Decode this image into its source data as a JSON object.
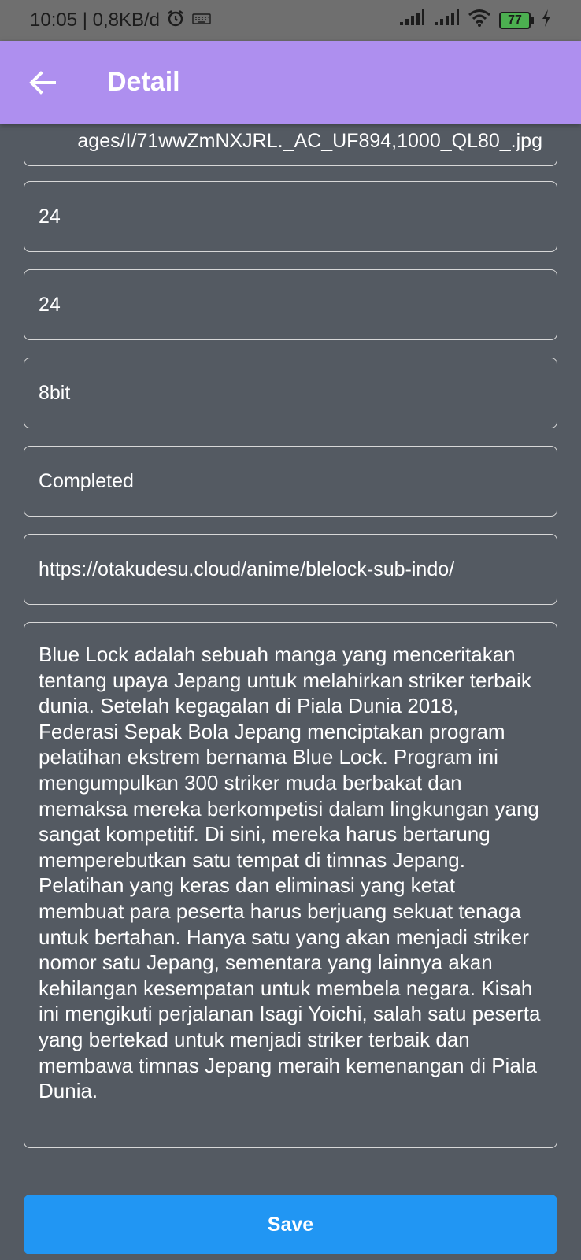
{
  "status_bar": {
    "time_speed": "10:05 | 0,8KB/d",
    "battery": "77"
  },
  "app_bar": {
    "title": "Detail"
  },
  "form": {
    "image_url": "ages/I/71wwZmNXJRL._AC_UF894,1000_QL80_.jpg",
    "field_1": "24",
    "field_2": "24",
    "studio": "8bit",
    "status": "Completed",
    "link": "https://otakudesu.cloud/anime/blelock-sub-indo/",
    "synopsis": "Blue Lock adalah sebuah manga yang menceritakan tentang upaya Jepang untuk melahirkan striker terbaik dunia. Setelah kegagalan di Piala Dunia 2018, Federasi Sepak Bola Jepang menciptakan program pelatihan ekstrem bernama Blue Lock. Program ini mengumpulkan 300 striker muda berbakat dan memaksa mereka berkompetisi dalam lingkungan yang sangat kompetitif. Di sini, mereka harus bertarung memperebutkan satu tempat di timnas Jepang. Pelatihan yang keras dan eliminasi yang ketat membuat para peserta harus berjuang sekuat tenaga untuk bertahan. Hanya satu yang akan menjadi striker nomor satu Jepang, sementara yang lainnya akan kehilangan kesempatan untuk membela negara. Kisah ini mengikuti perjalanan Isagi Yoichi, salah satu peserta yang bertekad untuk menjadi striker terbaik dan membawa timnas Jepang meraih kemenangan di Piala Dunia."
  },
  "actions": {
    "save_label": "Save"
  },
  "colors": {
    "app_bar": "#ae8fef",
    "background": "#545a62",
    "save_button": "#2196f3"
  }
}
